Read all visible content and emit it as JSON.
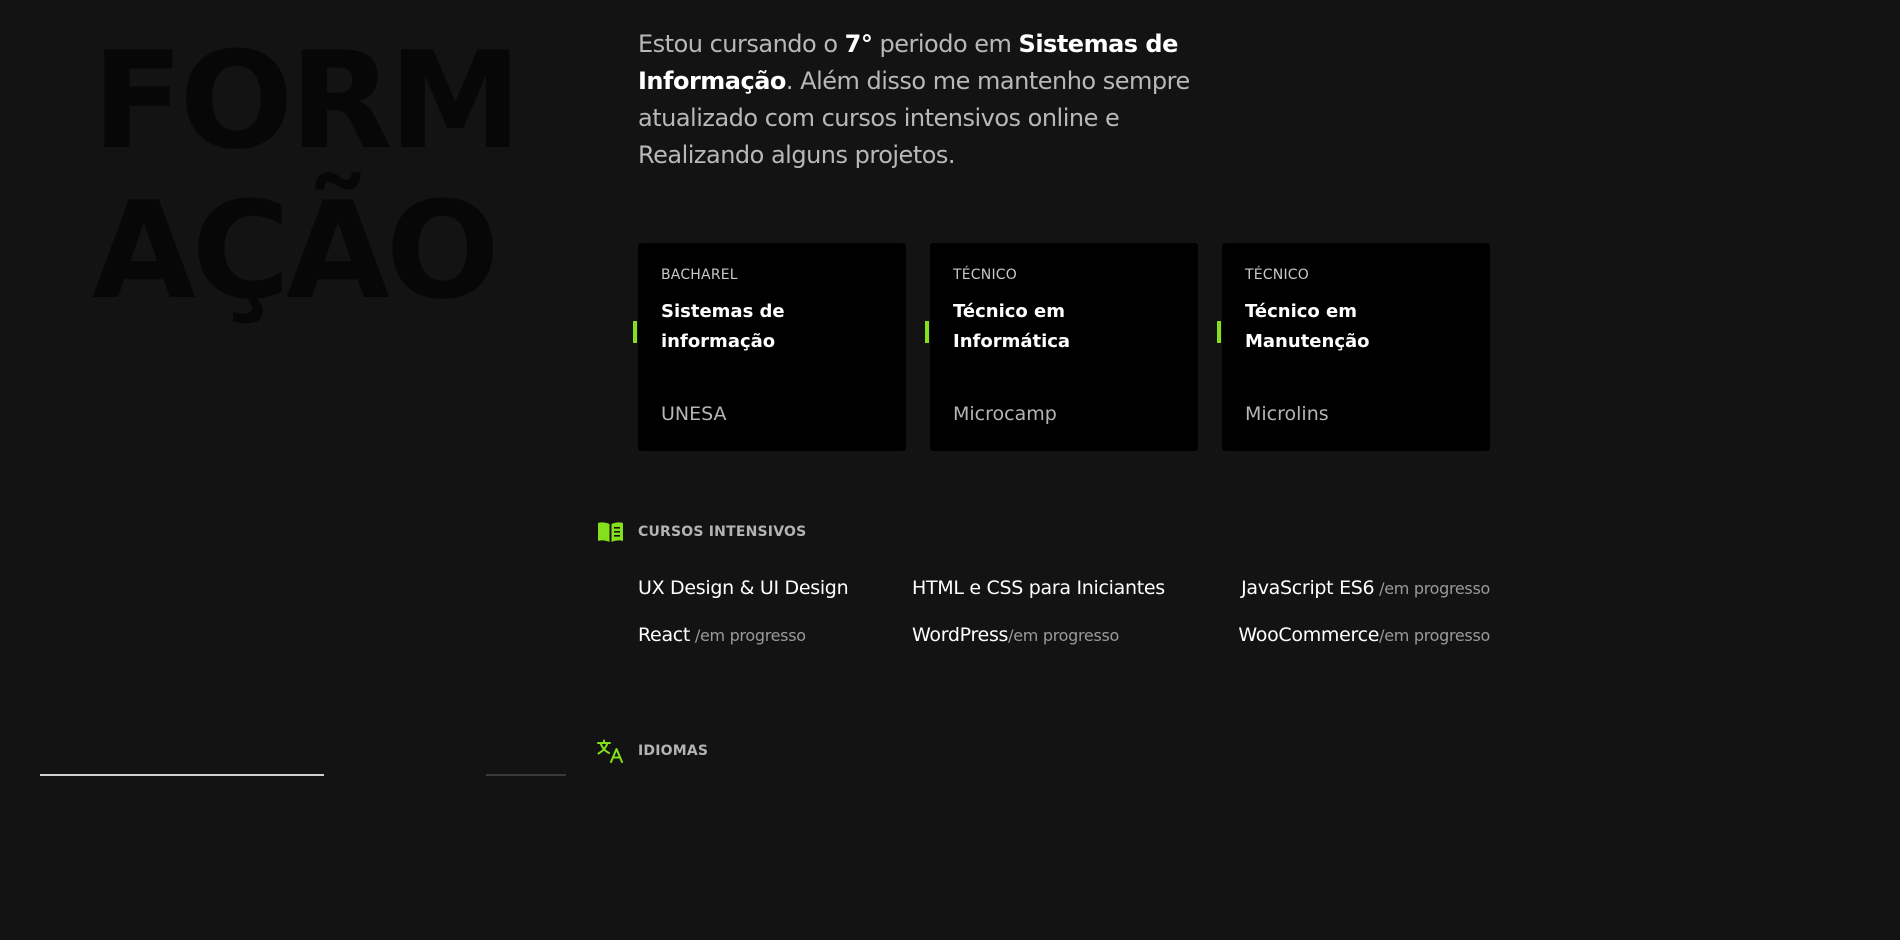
{
  "hero": {
    "title_line1": "FORM",
    "title_line2": "AÇÃO"
  },
  "intro": {
    "part1": "Estou cursando o ",
    "period": "7°",
    "part2": " periodo em ",
    "course": "Sistemas de Informação",
    "part3": ". Além disso me mantenho sempre atualizado com cursos intensivos online e Realizando alguns projetos."
  },
  "cards": [
    {
      "kind": "BACHAREL",
      "course": "Sistemas de informação",
      "school": "UNESA"
    },
    {
      "kind": "TÉCNICO",
      "course": "Técnico em Informática",
      "school": "Microcamp"
    },
    {
      "kind": "TÉCNICO",
      "course": "Técnico em Manutenção",
      "school": "Microlins"
    }
  ],
  "intensive": {
    "heading": "CURSOS INTENSIVOS",
    "icon": "book-icon",
    "items": [
      {
        "name": "UX Design & UI Design",
        "status": ""
      },
      {
        "name": "HTML e CSS para Iniciantes",
        "status": ""
      },
      {
        "name": "JavaScript ES6",
        "status": " /em progresso"
      },
      {
        "name": "React",
        "status": " /em progresso"
      },
      {
        "name": "WordPress",
        "status": "/em progresso"
      },
      {
        "name": "WooCommerce",
        "status": "/em progresso"
      }
    ]
  },
  "languages": {
    "heading": "IDIOMAS",
    "icon": "translate-icon"
  },
  "colors": {
    "background": "#131313",
    "accent": "#84e01d",
    "card": "#000000"
  }
}
